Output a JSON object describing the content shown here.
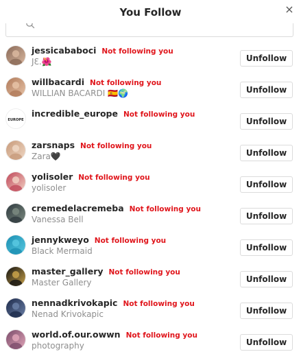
{
  "header": {
    "title": "You Follow",
    "close_glyph": "×"
  },
  "search": {
    "value": "",
    "placeholder": ""
  },
  "not_following_label": "Not following you",
  "unfollow_label": "Unfollow",
  "rows": [
    {
      "username": "jessicababoci",
      "full_name": "JƐ.🌺",
      "avatar_colors": [
        "#8a6a58",
        "#d9b79f"
      ]
    },
    {
      "username": "willbacardi",
      "full_name": "WILLIAN BACARDI 🇪🇸🌍",
      "avatar_colors": [
        "#b07a5a",
        "#e6c2a6"
      ]
    },
    {
      "username": "incredible_europe",
      "full_name": "",
      "avatar_text": "EUROPE",
      "avatar_colors": [
        "#ffffff",
        "#222222"
      ]
    },
    {
      "username": "zarsnaps",
      "full_name": "Zara🖤",
      "avatar_colors": [
        "#c79a7a",
        "#efd7c4"
      ]
    },
    {
      "username": "yolisoler",
      "full_name": "yolisoler",
      "avatar_colors": [
        "#c0485a",
        "#f1cfc2"
      ]
    },
    {
      "username": "cremedelacremeba",
      "full_name": "Vanessa Bell",
      "avatar_colors": [
        "#2f3a3f",
        "#7b8a80"
      ]
    },
    {
      "username": "jennykweyo",
      "full_name": "Black Mermaid",
      "avatar_colors": [
        "#1b8fb2",
        "#58c8e0"
      ]
    },
    {
      "username": "master_gallery",
      "full_name": "Master Gallery",
      "avatar_colors": [
        "#111111",
        "#c9a24a"
      ]
    },
    {
      "username": "nennadkrivokapic",
      "full_name": "Nenad Krivokapic",
      "avatar_colors": [
        "#1d2a4a",
        "#6a7fa6"
      ]
    },
    {
      "username": "world.of.our.owwn",
      "full_name": "photography",
      "avatar_colors": [
        "#7b4b6a",
        "#e0a5b8"
      ]
    }
  ]
}
